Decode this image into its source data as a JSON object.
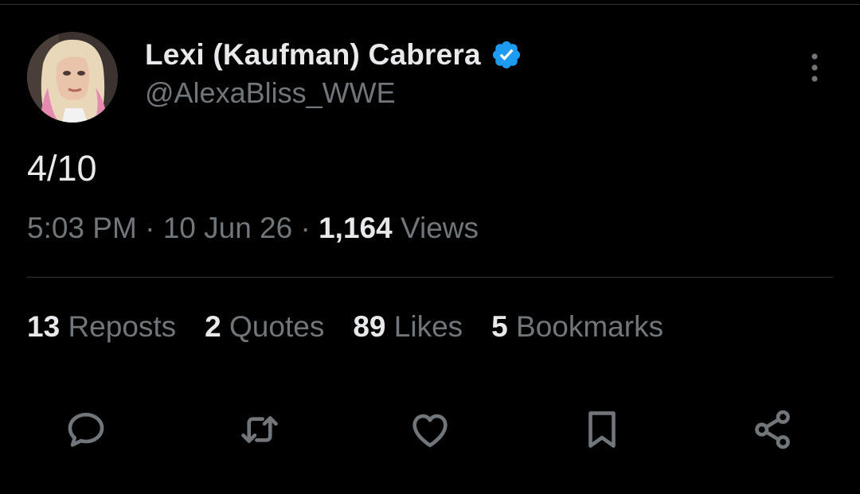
{
  "tweet": {
    "author": {
      "display_name": "Lexi (Kaufman) Cabrera",
      "handle": "@AlexaBliss_WWE",
      "verified_icon": "verified-badge-icon"
    },
    "text": "4/10",
    "meta": {
      "time": "5:03 PM",
      "separator": "·",
      "date": "10 Jun 26",
      "views_count": "1,164",
      "views_label": "Views"
    },
    "stats": [
      {
        "count": "13",
        "label": "Reposts"
      },
      {
        "count": "2",
        "label": "Quotes"
      },
      {
        "count": "89",
        "label": "Likes"
      },
      {
        "count": "5",
        "label": "Bookmarks"
      }
    ],
    "actions": [
      "reply-icon",
      "repost-icon",
      "like-icon",
      "bookmark-icon",
      "share-icon"
    ]
  },
  "colors": {
    "background": "#000000",
    "primary_text": "#e7e9ea",
    "secondary_text": "#71767b",
    "verified_blue": "#1d9bf0",
    "divider": "#2f3336"
  }
}
